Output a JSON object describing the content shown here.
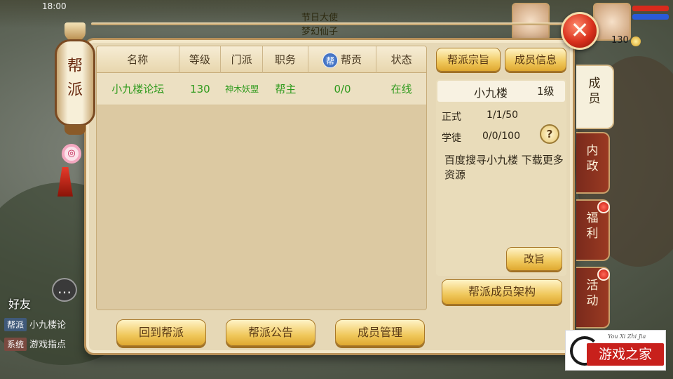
{
  "hud": {
    "time": "18:00",
    "festival_line1": "节日大使",
    "festival_line2": "梦幻仙子",
    "level": "130",
    "friend_label": "好友",
    "chat_icon": "…",
    "chat": [
      {
        "tag": "帮派",
        "text": "小九楼论"
      },
      {
        "tag": "系统",
        "text": "游戏指点"
      }
    ]
  },
  "lantern": {
    "title": "帮派",
    "charm_icon": "charm-icon"
  },
  "close_icon": "✕",
  "table": {
    "headers": [
      "名称",
      "等级",
      "门派",
      "职务",
      "帮贡",
      "状态"
    ],
    "contrib_badge": "帮",
    "rows": [
      {
        "name": "小九楼论坛",
        "level": "130",
        "school": "神木妖盟",
        "role": "帮主",
        "contrib": "0/0",
        "status": "在线"
      }
    ]
  },
  "right": {
    "tab_purpose": "帮派宗旨",
    "tab_members": "成员信息",
    "guild_name": "小九楼",
    "guild_level": "1级",
    "formal_label": "正式",
    "formal_value": "1/1/50",
    "apprentice_label": "学徒",
    "apprentice_value": "0/0/100",
    "help": "?",
    "notice": "百度搜寻小九楼 下载更多资源",
    "edit_button": "改旨",
    "structure_button": "帮派成员架构"
  },
  "bottom": {
    "back": "回到帮派",
    "announce": "帮派公告",
    "manage": "成员管理"
  },
  "side_tabs": [
    {
      "label": "成员",
      "active": true
    },
    {
      "label": "内政",
      "active": false
    },
    {
      "label": "福利",
      "active": false,
      "dot": true
    },
    {
      "label": "活动",
      "active": false,
      "dot": true
    }
  ],
  "logo": {
    "sub": "You Xi Zhi Jia",
    "text": "游戏之家"
  },
  "colors": {
    "online_green": "#2e9a1c",
    "button_gold": "#f0c85c",
    "tab_red": "#9a3a22"
  }
}
